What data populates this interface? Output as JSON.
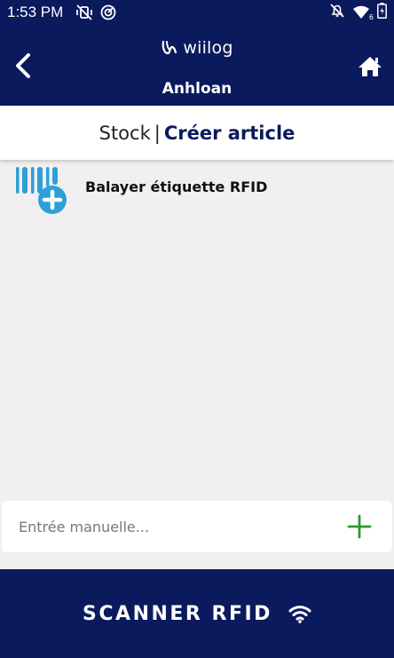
{
  "status_bar": {
    "time": "1:53 PM",
    "icons": [
      "mute-vibrate-icon",
      "sync-icon",
      "notifications-off-icon",
      "wifi-signal-icon",
      "battery-icon"
    ],
    "wifi_badge": "6"
  },
  "header": {
    "logo_text": "wiilog",
    "user_name": "Anhloan",
    "back_icon": "chevron-left-icon",
    "home_icon": "home-icon"
  },
  "tabs": {
    "stock_label": "Stock",
    "separator": "|",
    "create_label": "Créer article"
  },
  "scan_item": {
    "label": "Balayer étiquette RFID",
    "icon": "barcode-add-icon"
  },
  "manual_entry": {
    "placeholder": "Entrée manuelle...",
    "add_icon": "plus-icon"
  },
  "scan_button": {
    "label": "SCANNER RFID",
    "icon": "wifi-icon"
  },
  "colors": {
    "primary": "#0b1a5c",
    "accent_blue": "#2e9fd8",
    "add_green": "#2e9a2e",
    "background": "#f0f0f0"
  }
}
